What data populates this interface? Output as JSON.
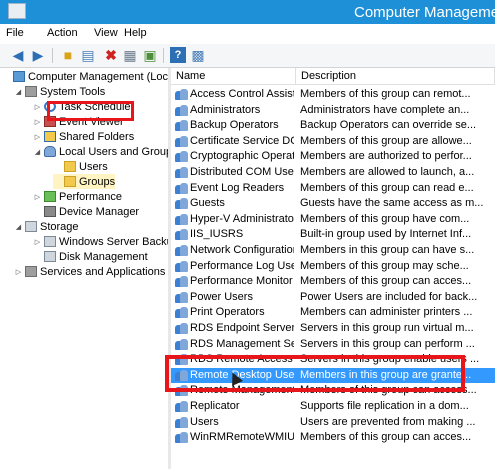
{
  "window": {
    "title": "Computer Management"
  },
  "menu": {
    "items": [
      "File",
      "Action",
      "View",
      "Help"
    ]
  },
  "toolbar": {
    "buttons": [
      "back-icon",
      "forward-icon",
      "up-folder-icon",
      "show-hide-tree-icon",
      "delete-icon",
      "properties-icon",
      "export-icon",
      "help-icon",
      "mmc-icon"
    ]
  },
  "tree": {
    "root": "Computer Management (Local",
    "system_tools": "System Tools",
    "task_scheduler": "Task Scheduler",
    "event_viewer": "Event Viewer",
    "shared_folders": "Shared Folders",
    "local_users_groups": "Local Users and Groups",
    "users": "Users",
    "groups": "Groups",
    "performance": "Performance",
    "device_manager": "Device Manager",
    "storage": "Storage",
    "windows_server_backup": "Windows Server Backup",
    "disk_management": "Disk Management",
    "services_apps": "Services and Applications"
  },
  "list": {
    "columns": {
      "name": "Name",
      "description": "Description"
    },
    "rows": [
      {
        "name": "Access Control Assist...",
        "description": "Members of this group can remot..."
      },
      {
        "name": "Administrators",
        "description": "Administrators have complete an..."
      },
      {
        "name": "Backup Operators",
        "description": "Backup Operators can override se..."
      },
      {
        "name": "Certificate Service DC...",
        "description": "Members of this group are allowe..."
      },
      {
        "name": "Cryptographic Operat...",
        "description": "Members are authorized to perfor..."
      },
      {
        "name": "Distributed COM Users",
        "description": "Members are allowed to launch, a..."
      },
      {
        "name": "Event Log Readers",
        "description": "Members of this group can read e..."
      },
      {
        "name": "Guests",
        "description": "Guests have the same access as m..."
      },
      {
        "name": "Hyper-V Administrators",
        "description": "Members of this group have com..."
      },
      {
        "name": "IIS_IUSRS",
        "description": "Built-in group used by Internet Inf..."
      },
      {
        "name": "Network Configuration...",
        "description": "Members in this group can have s..."
      },
      {
        "name": "Performance Log Users",
        "description": "Members of this group may sche..."
      },
      {
        "name": "Performance Monitor ...",
        "description": "Members of this group can acces..."
      },
      {
        "name": "Power Users",
        "description": "Power Users are included for back..."
      },
      {
        "name": "Print Operators",
        "description": "Members can administer printers ..."
      },
      {
        "name": "RDS Endpoint Servers",
        "description": "Servers in this group run virtual m..."
      },
      {
        "name": "RDS Management Ser...",
        "description": "Servers in this group can perform ..."
      },
      {
        "name": "RDS Remote Access S...",
        "description": "Servers in this group enable users ..."
      },
      {
        "name": "Remote Desktop Users",
        "description": "Members in this group are grante...",
        "selected": true
      },
      {
        "name": "Remote Management...",
        "description": "Members of this group can access..."
      },
      {
        "name": "Replicator",
        "description": "Supports file replication in a dom..."
      },
      {
        "name": "Users",
        "description": "Users are prevented from making ..."
      },
      {
        "name": "WinRMRemoteWMIU...",
        "description": "Members of this group can acces..."
      }
    ]
  },
  "colors": {
    "accent": "#1e90d8",
    "selection": "#3399ff",
    "highlight": "#e8161b"
  }
}
